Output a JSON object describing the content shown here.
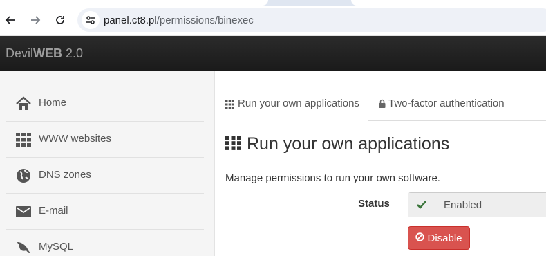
{
  "browser": {
    "url_host": "panel.ct8.pl",
    "url_path": "/permissions/binexec",
    "icons": [
      "back-icon",
      "forward-icon",
      "reload-icon",
      "site-info-icon"
    ]
  },
  "app": {
    "brand_prefix": "Devil",
    "brand_bold": "WEB",
    "brand_version": " 2.0"
  },
  "sidebar": {
    "items": [
      {
        "label": "Home",
        "icon": "home-icon"
      },
      {
        "label": "WWW websites",
        "icon": "grid-icon"
      },
      {
        "label": "DNS zones",
        "icon": "globe-icon"
      },
      {
        "label": "E-mail",
        "icon": "envelope-icon"
      },
      {
        "label": "MySQL",
        "icon": "dolphin-icon"
      }
    ]
  },
  "tabs": [
    {
      "label": "Run your own applications",
      "icon": "grid-icon",
      "active": true
    },
    {
      "label": "Two-factor authentication",
      "icon": "lock-icon",
      "active": false
    }
  ],
  "main": {
    "heading": "Run your own applications",
    "description": "Manage permissions to run your own software.",
    "status_label": "Status",
    "status_value": "Enabled",
    "disable_label": "Disable"
  },
  "colors": {
    "header_bg": "#222222",
    "danger": "#d9534f",
    "success": "#3c763d"
  }
}
